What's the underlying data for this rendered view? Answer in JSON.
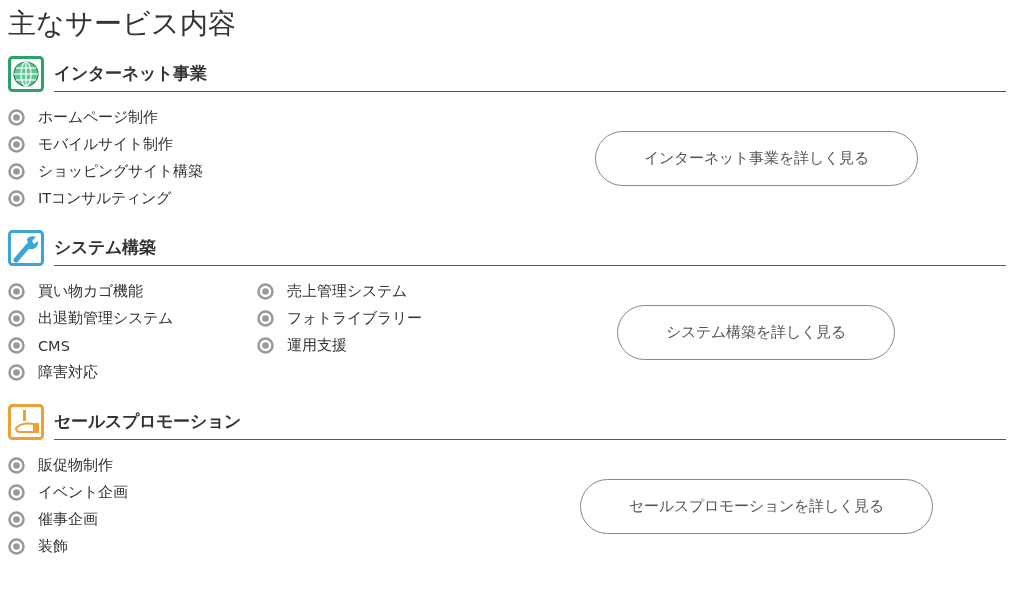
{
  "page_title": "主なサービス内容",
  "sections": [
    {
      "kind": "globe",
      "title": "インターネット事業",
      "columns": [
        [
          "ホームページ制作",
          "モバイルサイト制作",
          "ショッピングサイト構築",
          "ITコンサルティング"
        ]
      ],
      "button": "インターネット事業を詳しく見る"
    },
    {
      "kind": "wrench",
      "title": "システム構築",
      "columns": [
        [
          "買い物カゴ機能",
          "出退勤管理システム",
          "CMS",
          "障害対応"
        ],
        [
          "売上管理システム",
          "フォトライブラリー",
          "運用支援"
        ]
      ],
      "button": "システム構築を詳しく見る"
    },
    {
      "kind": "promo",
      "title": "セールスプロモーション",
      "columns": [
        [
          "販促物制作",
          "イベント企画",
          "催事企画",
          "装飾"
        ]
      ],
      "button": "セールスプロモーションを詳しく見る"
    }
  ]
}
